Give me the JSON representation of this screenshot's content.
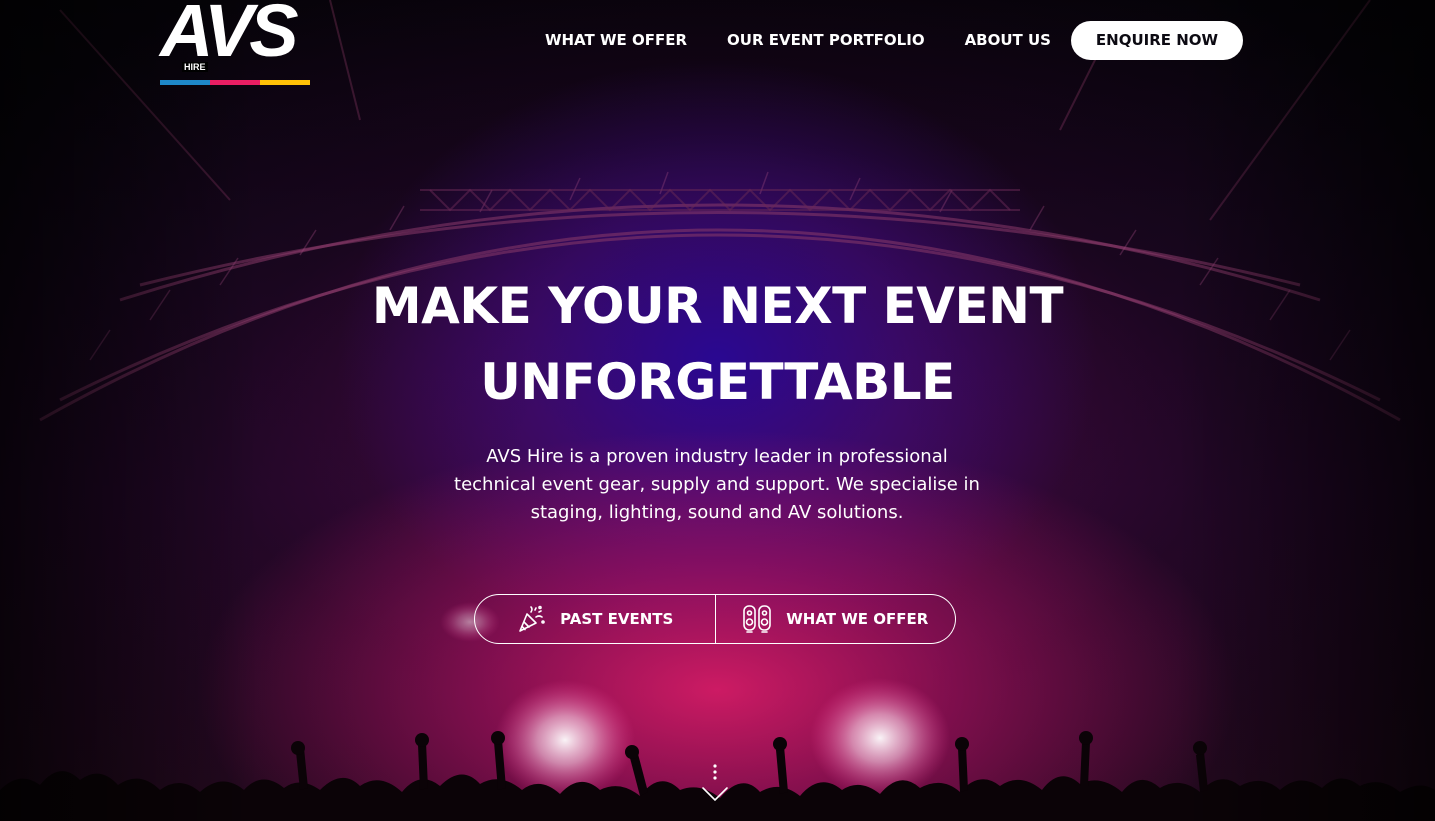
{
  "brand": {
    "logo_text": "AVS",
    "logo_subtext": "HIRE",
    "bar_colors": [
      "#1e88c8",
      "#e91e63",
      "#ffc107"
    ]
  },
  "nav": {
    "items": [
      {
        "label": "WHAT WE OFFER"
      },
      {
        "label": "OUR EVENT PORTFOLIO"
      },
      {
        "label": "ABOUT US"
      }
    ],
    "cta_label": "ENQUIRE NOW"
  },
  "hero": {
    "headline_line1": "MAKE YOUR NEXT EVENT",
    "headline_line2": "UNFORGETTABLE",
    "description": "AVS Hire is a proven industry leader in professional technical event gear, supply and support. We specialise in staging, lighting, sound and AV solutions.",
    "buttons": [
      {
        "label": "PAST EVENTS",
        "icon": "party-popper-icon"
      },
      {
        "label": "WHAT WE OFFER",
        "icon": "speakers-icon"
      }
    ]
  },
  "colors": {
    "accent_pink": "#e91e6e",
    "accent_blue": "#2a0a96",
    "text": "#ffffff"
  }
}
